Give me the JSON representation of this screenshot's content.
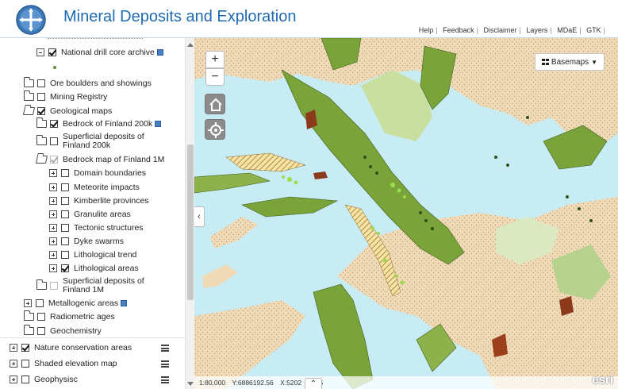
{
  "header": {
    "title": "Mineral Deposits and Exploration",
    "links": [
      "Help",
      "Feedback",
      "Disclaimer",
      "Layers",
      "MDaE",
      "GTK"
    ]
  },
  "layers": {
    "national_drill_core": "National drill core archive",
    "ore_boulders": "Ore boulders and showings",
    "mining_registry": "Mining Registry",
    "geological_maps": "Geological maps",
    "bedrock_200k": "Bedrock of Finland 200k",
    "superficial_200k": "Superficial deposits of Finland 200k",
    "bedrock_1m": "Bedrock map of Finland 1M",
    "sublayers": [
      {
        "label": "Domain boundaries",
        "checked": false
      },
      {
        "label": "Meteorite impacts",
        "checked": false
      },
      {
        "label": "Kimberlite provinces",
        "checked": false
      },
      {
        "label": "Granulite areas",
        "checked": false
      },
      {
        "label": "Tectonic structures",
        "checked": false
      },
      {
        "label": "Dyke swarms",
        "checked": false
      },
      {
        "label": "Lithological trend",
        "checked": false
      },
      {
        "label": "Lithological areas",
        "checked": true
      }
    ],
    "superficial_1m": "Superficial deposits of Finland 1M",
    "metallogenic": "Metallogenic areas",
    "radiometric": "Radiometric ages",
    "geochemistry": "Geochemistry",
    "nature_conservation": "Nature conservation areas",
    "shaded_elevation": "Shaded elevation map",
    "geophysics": "Geophysisc"
  },
  "map": {
    "zoom_in": "+",
    "zoom_out": "−",
    "basemaps_label": "Basemaps",
    "scale": "1:80,000",
    "y_coord": "Y:6886192.56",
    "x_coord": "X:5202",
    "x_coord_suffix": "5",
    "attribution_logo": "esri",
    "collapse_glyph": "‹",
    "expand_glyph": "⌃"
  },
  "colors": {
    "title_blue": "#1f6bb0",
    "water": "#c7ecf4",
    "sand": "#f0d9b5",
    "bedrock_green": "#7aa33a",
    "light_green": "#c8dfa0"
  },
  "icons": [
    "finland-logo-icon",
    "folder-icon",
    "checkbox-icon",
    "info-icon",
    "hamburger-menu-icon",
    "home-icon",
    "locate-icon",
    "grid-icon",
    "chevron-down-icon",
    "chevron-left-icon",
    "chevron-up-icon"
  ]
}
